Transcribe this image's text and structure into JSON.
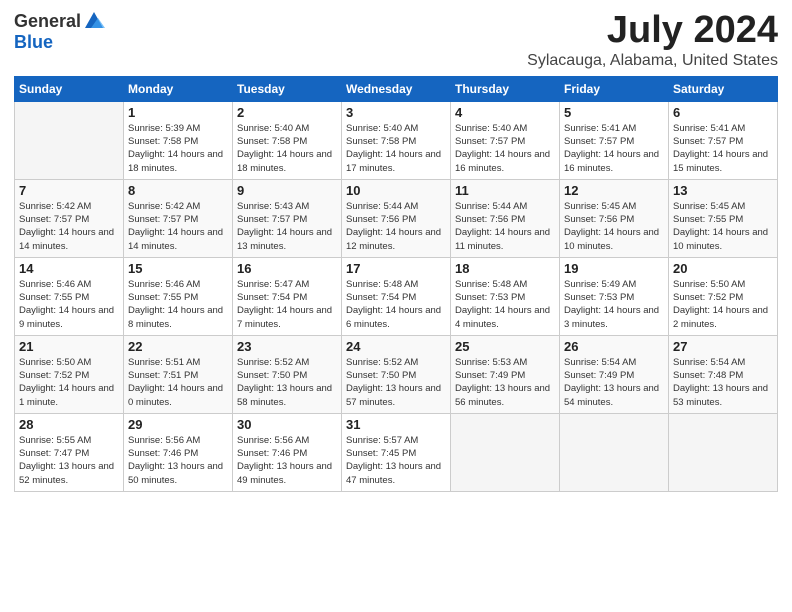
{
  "header": {
    "logo_general": "General",
    "logo_blue": "Blue",
    "month": "July 2024",
    "location": "Sylacauga, Alabama, United States"
  },
  "weekdays": [
    "Sunday",
    "Monday",
    "Tuesday",
    "Wednesday",
    "Thursday",
    "Friday",
    "Saturday"
  ],
  "weeks": [
    [
      {
        "day": "",
        "empty": true
      },
      {
        "day": "1",
        "sunrise": "Sunrise: 5:39 AM",
        "sunset": "Sunset: 7:58 PM",
        "daylight": "Daylight: 14 hours and 18 minutes."
      },
      {
        "day": "2",
        "sunrise": "Sunrise: 5:40 AM",
        "sunset": "Sunset: 7:58 PM",
        "daylight": "Daylight: 14 hours and 18 minutes."
      },
      {
        "day": "3",
        "sunrise": "Sunrise: 5:40 AM",
        "sunset": "Sunset: 7:58 PM",
        "daylight": "Daylight: 14 hours and 17 minutes."
      },
      {
        "day": "4",
        "sunrise": "Sunrise: 5:40 AM",
        "sunset": "Sunset: 7:57 PM",
        "daylight": "Daylight: 14 hours and 16 minutes."
      },
      {
        "day": "5",
        "sunrise": "Sunrise: 5:41 AM",
        "sunset": "Sunset: 7:57 PM",
        "daylight": "Daylight: 14 hours and 16 minutes."
      },
      {
        "day": "6",
        "sunrise": "Sunrise: 5:41 AM",
        "sunset": "Sunset: 7:57 PM",
        "daylight": "Daylight: 14 hours and 15 minutes."
      }
    ],
    [
      {
        "day": "7",
        "sunrise": "Sunrise: 5:42 AM",
        "sunset": "Sunset: 7:57 PM",
        "daylight": "Daylight: 14 hours and 14 minutes."
      },
      {
        "day": "8",
        "sunrise": "Sunrise: 5:42 AM",
        "sunset": "Sunset: 7:57 PM",
        "daylight": "Daylight: 14 hours and 14 minutes."
      },
      {
        "day": "9",
        "sunrise": "Sunrise: 5:43 AM",
        "sunset": "Sunset: 7:57 PM",
        "daylight": "Daylight: 14 hours and 13 minutes."
      },
      {
        "day": "10",
        "sunrise": "Sunrise: 5:44 AM",
        "sunset": "Sunset: 7:56 PM",
        "daylight": "Daylight: 14 hours and 12 minutes."
      },
      {
        "day": "11",
        "sunrise": "Sunrise: 5:44 AM",
        "sunset": "Sunset: 7:56 PM",
        "daylight": "Daylight: 14 hours and 11 minutes."
      },
      {
        "day": "12",
        "sunrise": "Sunrise: 5:45 AM",
        "sunset": "Sunset: 7:56 PM",
        "daylight": "Daylight: 14 hours and 10 minutes."
      },
      {
        "day": "13",
        "sunrise": "Sunrise: 5:45 AM",
        "sunset": "Sunset: 7:55 PM",
        "daylight": "Daylight: 14 hours and 10 minutes."
      }
    ],
    [
      {
        "day": "14",
        "sunrise": "Sunrise: 5:46 AM",
        "sunset": "Sunset: 7:55 PM",
        "daylight": "Daylight: 14 hours and 9 minutes."
      },
      {
        "day": "15",
        "sunrise": "Sunrise: 5:46 AM",
        "sunset": "Sunset: 7:55 PM",
        "daylight": "Daylight: 14 hours and 8 minutes."
      },
      {
        "day": "16",
        "sunrise": "Sunrise: 5:47 AM",
        "sunset": "Sunset: 7:54 PM",
        "daylight": "Daylight: 14 hours and 7 minutes."
      },
      {
        "day": "17",
        "sunrise": "Sunrise: 5:48 AM",
        "sunset": "Sunset: 7:54 PM",
        "daylight": "Daylight: 14 hours and 6 minutes."
      },
      {
        "day": "18",
        "sunrise": "Sunrise: 5:48 AM",
        "sunset": "Sunset: 7:53 PM",
        "daylight": "Daylight: 14 hours and 4 minutes."
      },
      {
        "day": "19",
        "sunrise": "Sunrise: 5:49 AM",
        "sunset": "Sunset: 7:53 PM",
        "daylight": "Daylight: 14 hours and 3 minutes."
      },
      {
        "day": "20",
        "sunrise": "Sunrise: 5:50 AM",
        "sunset": "Sunset: 7:52 PM",
        "daylight": "Daylight: 14 hours and 2 minutes."
      }
    ],
    [
      {
        "day": "21",
        "sunrise": "Sunrise: 5:50 AM",
        "sunset": "Sunset: 7:52 PM",
        "daylight": "Daylight: 14 hours and 1 minute."
      },
      {
        "day": "22",
        "sunrise": "Sunrise: 5:51 AM",
        "sunset": "Sunset: 7:51 PM",
        "daylight": "Daylight: 14 hours and 0 minutes."
      },
      {
        "day": "23",
        "sunrise": "Sunrise: 5:52 AM",
        "sunset": "Sunset: 7:50 PM",
        "daylight": "Daylight: 13 hours and 58 minutes."
      },
      {
        "day": "24",
        "sunrise": "Sunrise: 5:52 AM",
        "sunset": "Sunset: 7:50 PM",
        "daylight": "Daylight: 13 hours and 57 minutes."
      },
      {
        "day": "25",
        "sunrise": "Sunrise: 5:53 AM",
        "sunset": "Sunset: 7:49 PM",
        "daylight": "Daylight: 13 hours and 56 minutes."
      },
      {
        "day": "26",
        "sunrise": "Sunrise: 5:54 AM",
        "sunset": "Sunset: 7:49 PM",
        "daylight": "Daylight: 13 hours and 54 minutes."
      },
      {
        "day": "27",
        "sunrise": "Sunrise: 5:54 AM",
        "sunset": "Sunset: 7:48 PM",
        "daylight": "Daylight: 13 hours and 53 minutes."
      }
    ],
    [
      {
        "day": "28",
        "sunrise": "Sunrise: 5:55 AM",
        "sunset": "Sunset: 7:47 PM",
        "daylight": "Daylight: 13 hours and 52 minutes."
      },
      {
        "day": "29",
        "sunrise": "Sunrise: 5:56 AM",
        "sunset": "Sunset: 7:46 PM",
        "daylight": "Daylight: 13 hours and 50 minutes."
      },
      {
        "day": "30",
        "sunrise": "Sunrise: 5:56 AM",
        "sunset": "Sunset: 7:46 PM",
        "daylight": "Daylight: 13 hours and 49 minutes."
      },
      {
        "day": "31",
        "sunrise": "Sunrise: 5:57 AM",
        "sunset": "Sunset: 7:45 PM",
        "daylight": "Daylight: 13 hours and 47 minutes."
      },
      {
        "day": "",
        "empty": true
      },
      {
        "day": "",
        "empty": true
      },
      {
        "day": "",
        "empty": true
      }
    ]
  ]
}
